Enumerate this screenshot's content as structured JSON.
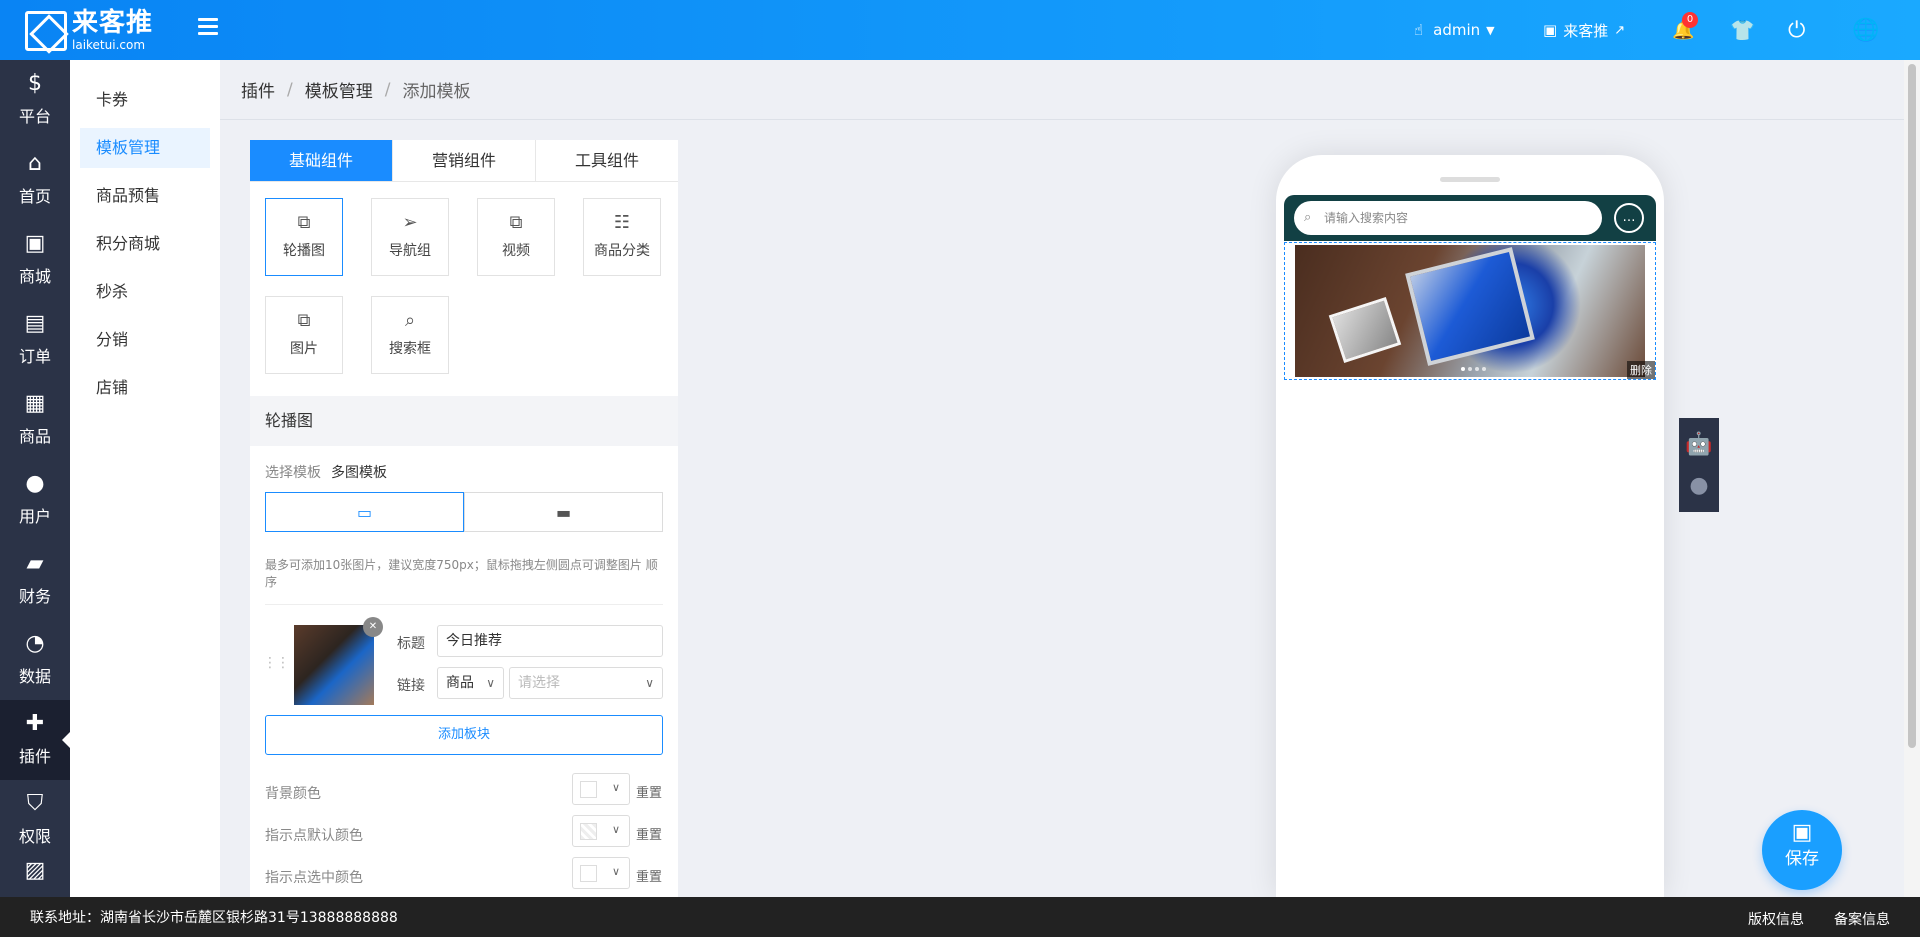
{
  "header": {
    "logo_cn": "来客推",
    "logo_en": "laiketui.com",
    "user": "admin",
    "shop": "来客推",
    "notifications": "0"
  },
  "sidebar": {
    "items": [
      {
        "label": "平台",
        "icon": "dollar-icon"
      },
      {
        "label": "首页",
        "icon": "home-icon"
      },
      {
        "label": "商城",
        "icon": "store-icon"
      },
      {
        "label": "订单",
        "icon": "clipboard-icon"
      },
      {
        "label": "商品",
        "icon": "bag-icon"
      },
      {
        "label": "用户",
        "icon": "user-icon"
      },
      {
        "label": "财务",
        "icon": "wallet-icon"
      },
      {
        "label": "数据",
        "icon": "pie-chart-icon"
      },
      {
        "label": "插件",
        "icon": "puzzle-icon"
      },
      {
        "label": "权限",
        "icon": "shield-icon"
      }
    ]
  },
  "subnav": {
    "items": [
      "卡券",
      "模板管理",
      "商品预售",
      "积分商城",
      "秒杀",
      "分销",
      "店铺"
    ]
  },
  "breadcrumb": {
    "a": "插件",
    "b": "模板管理",
    "c": "添加模板",
    "sep": "/"
  },
  "panel": {
    "tabs": [
      "基础组件",
      "营销组件",
      "工具组件"
    ],
    "components": [
      "轮播图",
      "导航组",
      "视频",
      "商品分类",
      "图片",
      "搜索框"
    ],
    "section_title": "轮播图",
    "template_label": "选择模板",
    "template_value": "多图模板",
    "hint": "最多可添加10张图片，建议宽度750px；鼠标拖拽左侧圆点可调整图片 顺序",
    "item": {
      "title_label": "标题",
      "title_value": "今日推荐",
      "link_label": "链接",
      "link_type": "商品",
      "link_placeholder": "请选择"
    },
    "add_block": "添加板块",
    "colors": [
      {
        "label": "背景颜色",
        "reset": "重置"
      },
      {
        "label": "指示点默认颜色",
        "reset": "重置"
      },
      {
        "label": "指示点选中颜色",
        "reset": "重置"
      }
    ]
  },
  "preview": {
    "search_placeholder": "请输入搜索内容",
    "delete_tag": "删除"
  },
  "save": "保存",
  "footer": {
    "address": "联系地址：湖南省长沙市岳麓区银杉路31号13888888888",
    "copyright": "版权信息",
    "record": "备案信息"
  },
  "colors": {
    "primary": "#1a8cff",
    "sidebar": "#2b3347",
    "header_start": "#0984f4",
    "header_end": "#1aa9ff"
  }
}
